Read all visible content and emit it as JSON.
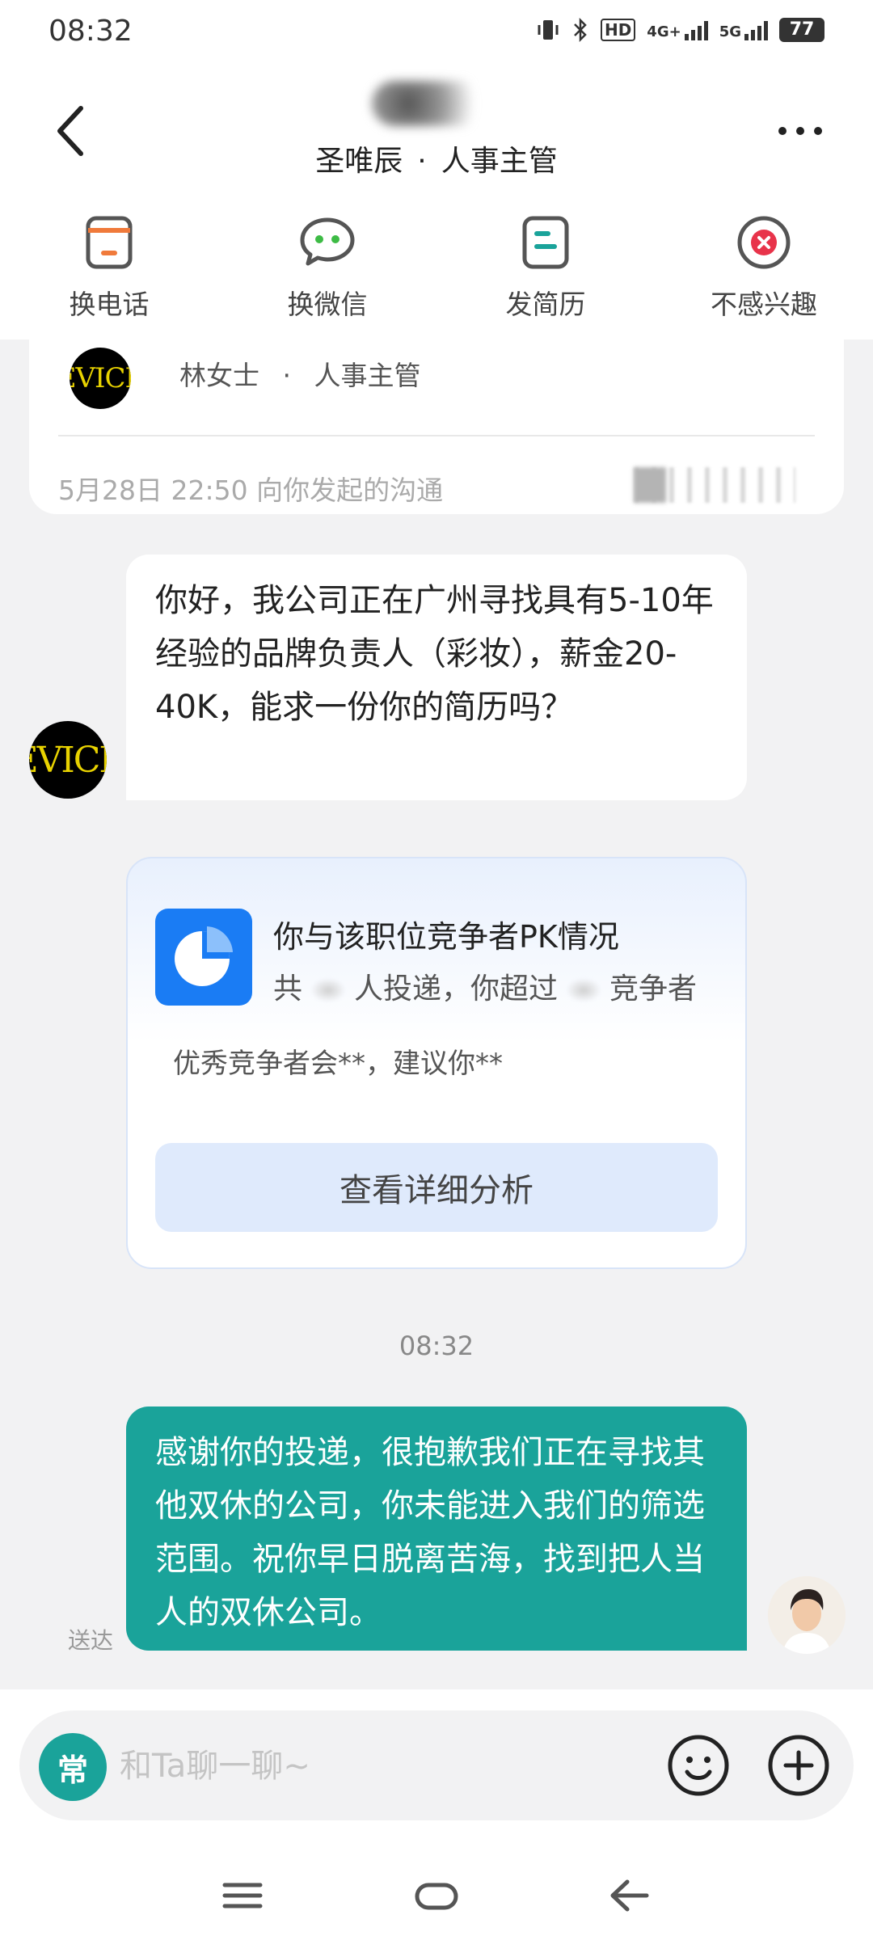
{
  "status_bar": {
    "time": "08:32",
    "network": "HD",
    "net1": "4G+",
    "net2": "5G",
    "battery": "77"
  },
  "header": {
    "name_sub": "圣唯辰",
    "dot": "·",
    "role": "人事主管"
  },
  "actions": [
    {
      "label": "换电话",
      "icon": "phone-swap-icon",
      "color": "#f07a3b"
    },
    {
      "label": "换微信",
      "icon": "wechat-icon",
      "color": "#3dbb45"
    },
    {
      "label": "发简历",
      "icon": "resume-icon",
      "color": "#1aa39a"
    },
    {
      "label": "不感兴趣",
      "icon": "not-interested-icon",
      "color": "#e8334a"
    }
  ],
  "top_card": {
    "avatar_text": "EVICE",
    "contact_name": "林女士",
    "dot": "·",
    "contact_role": "人事主管",
    "initiated": "5月28日 22:50 向你发起的沟通"
  },
  "incoming_message": {
    "avatar_text": "EVICE",
    "text": "你好，我公司正在广州寻找具有5-10年经验的品牌负责人（彩妆），薪金20-40K，能求一份你的简历吗？"
  },
  "pk_card": {
    "title": "你与该职位竞争者PK情况",
    "sub_prefix": "共",
    "sub_mid": "人投递，你超过",
    "sub_suffix": "竞争者",
    "tip": "优秀竞争者会**，建议你**",
    "button": "查看详细分析"
  },
  "timestamp": "08:32",
  "outgoing_message": {
    "text": "感谢你的投递，很抱歉我们正在寻找其他双休的公司，你未能进入我们的筛选范围。祝你早日脱离苦海，找到把人当人的双休公司。",
    "status": "送达"
  },
  "composer": {
    "quick_label": "常",
    "placeholder": "和Ta聊一聊~"
  },
  "colors": {
    "accent": "#1aa39a",
    "pk_blue": "#1a7cf4"
  }
}
